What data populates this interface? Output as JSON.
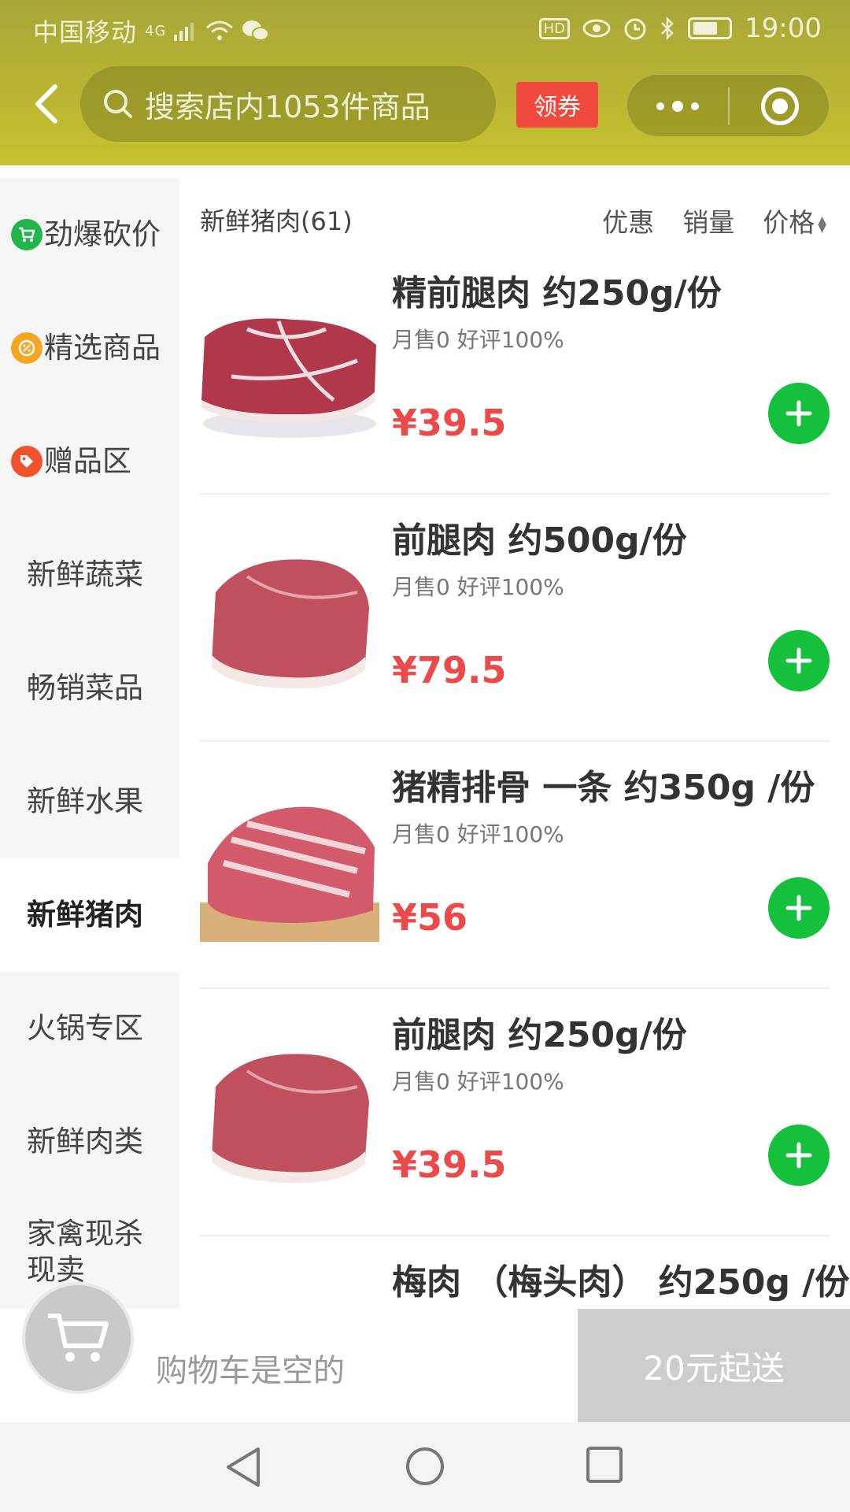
{
  "status_bar": {
    "carrier": "中国移动",
    "network": "4G",
    "time": "19:00",
    "hd_label": "HD"
  },
  "header": {
    "search_placeholder": "搜索店内1053件商品",
    "coupon_label": "领券"
  },
  "sidebar": {
    "items": [
      {
        "label": "劲爆砍价",
        "icon": "cart-badge-icon",
        "icon_color": "#22b64a"
      },
      {
        "label": "精选商品",
        "icon": "discount-badge-icon",
        "icon_color": "#f5a623"
      },
      {
        "label": "赠品区",
        "icon": "tag-badge-icon",
        "icon_color": "#f0522d"
      },
      {
        "label": "新鲜蔬菜"
      },
      {
        "label": "畅销菜品"
      },
      {
        "label": "新鲜水果"
      },
      {
        "label": "新鲜猪肉",
        "active": true
      },
      {
        "label": "火锅专区"
      },
      {
        "label": "新鲜肉类"
      },
      {
        "label": "家禽现杀现卖"
      }
    ]
  },
  "category": {
    "title": "新鲜猪肉(61)",
    "sorts": [
      "优惠",
      "销量",
      "价格"
    ]
  },
  "products": [
    {
      "name": "精前腿肉 约250g/份",
      "meta": "月售0  好评100%",
      "price": "¥39.5"
    },
    {
      "name": "前腿肉 约500g/份",
      "meta": "月售0  好评100%",
      "price": "¥79.5"
    },
    {
      "name": "猪精排骨 一条 约350g /份",
      "meta": "月售0  好评100%",
      "price": "¥56"
    },
    {
      "name": "前腿肉 约250g/份",
      "meta": "月售0  好评100%",
      "price": "¥39.5"
    },
    {
      "name": "梅肉 （梅头肉） 约250g /份",
      "meta": "",
      "price": ""
    }
  ],
  "cart": {
    "empty_text": "购物车是空的",
    "min_order": "20元起送"
  },
  "colors": {
    "header": "#b9b533",
    "price": "#ec4a4a",
    "add_button": "#14c03c"
  }
}
